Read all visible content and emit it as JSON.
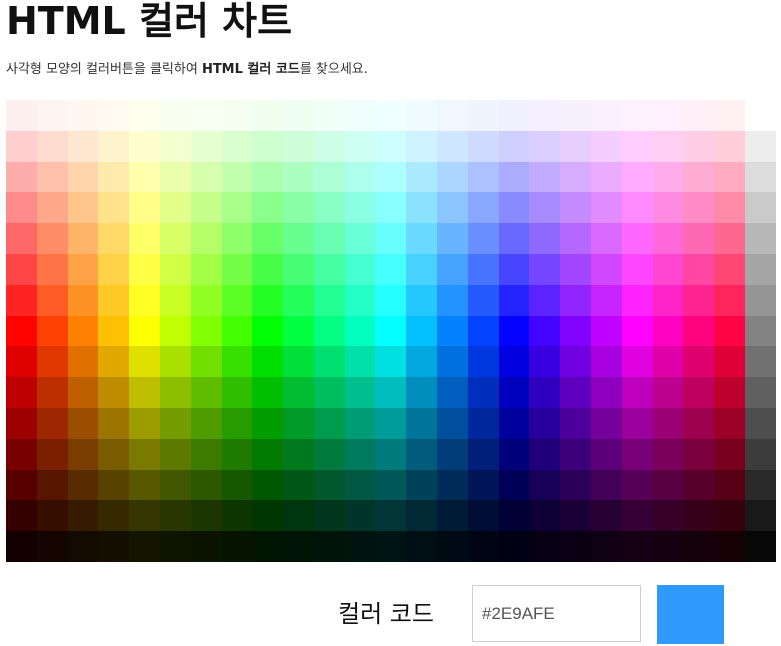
{
  "page": {
    "title": "HTML 컬러 차트",
    "subtitle_pre": "사각형 모양의 컬러버튼을 클릭하여 ",
    "subtitle_bold": "HTML 컬러 코드",
    "subtitle_post": "를 찾으세요."
  },
  "palette": {
    "hues": 24,
    "lightness_rows": 15,
    "hue_start_deg": 0,
    "grayscale_column": true
  },
  "color_code": {
    "label": "컬러 코드",
    "value": "#2E9AFE",
    "preview_color": "#2E9AFE"
  }
}
